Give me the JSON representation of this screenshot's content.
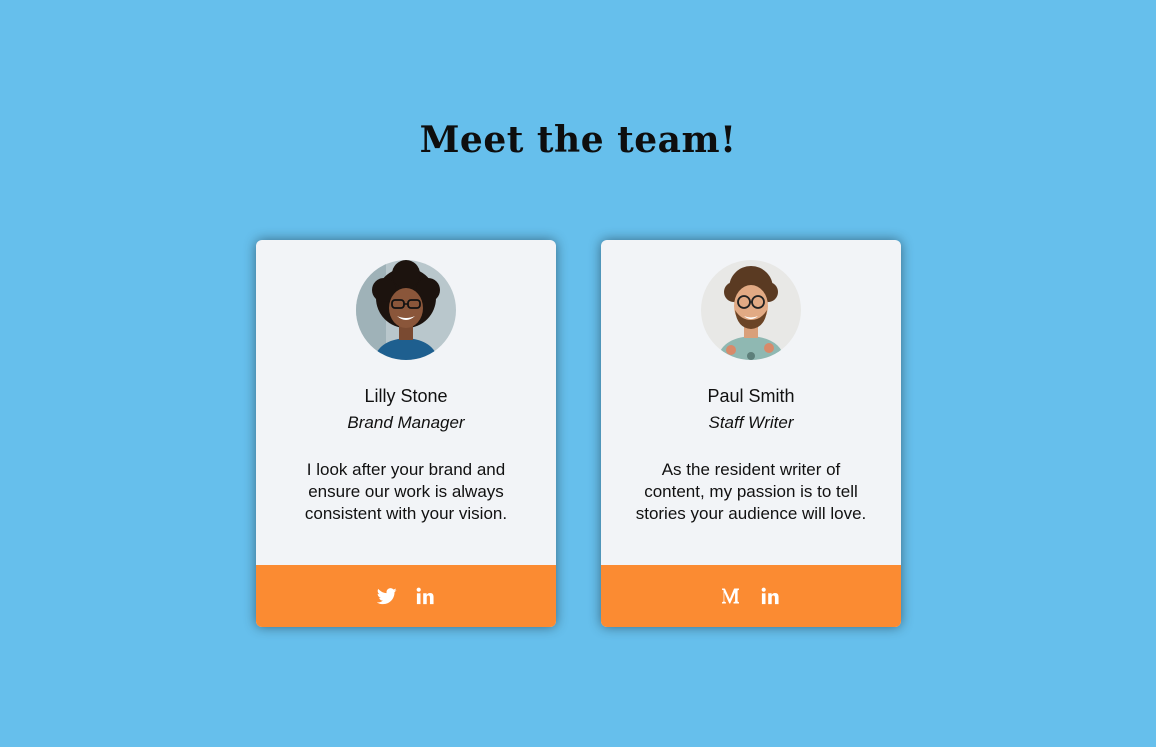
{
  "page": {
    "title": "Meet the team!"
  },
  "team": [
    {
      "name": "Lilly Stone",
      "role": "Brand Manager",
      "bio": "I look after your brand and ensure our work is always consistent with your vision.",
      "avatar_icon": "portrait-woman-curly-hair-glasses",
      "social": [
        "twitter-icon",
        "linkedin-icon"
      ]
    },
    {
      "name": "Paul Smith",
      "role": "Staff Writer",
      "bio": "As the resident writer of content, my passion is to tell stories your audience will love.",
      "avatar_icon": "portrait-man-curly-hair-glasses",
      "social": [
        "medium-icon",
        "linkedin-icon"
      ]
    }
  ],
  "colors": {
    "background": "#66bfec",
    "card": "#f2f4f7",
    "footer": "#fb8b32",
    "icon": "#ffffff"
  }
}
